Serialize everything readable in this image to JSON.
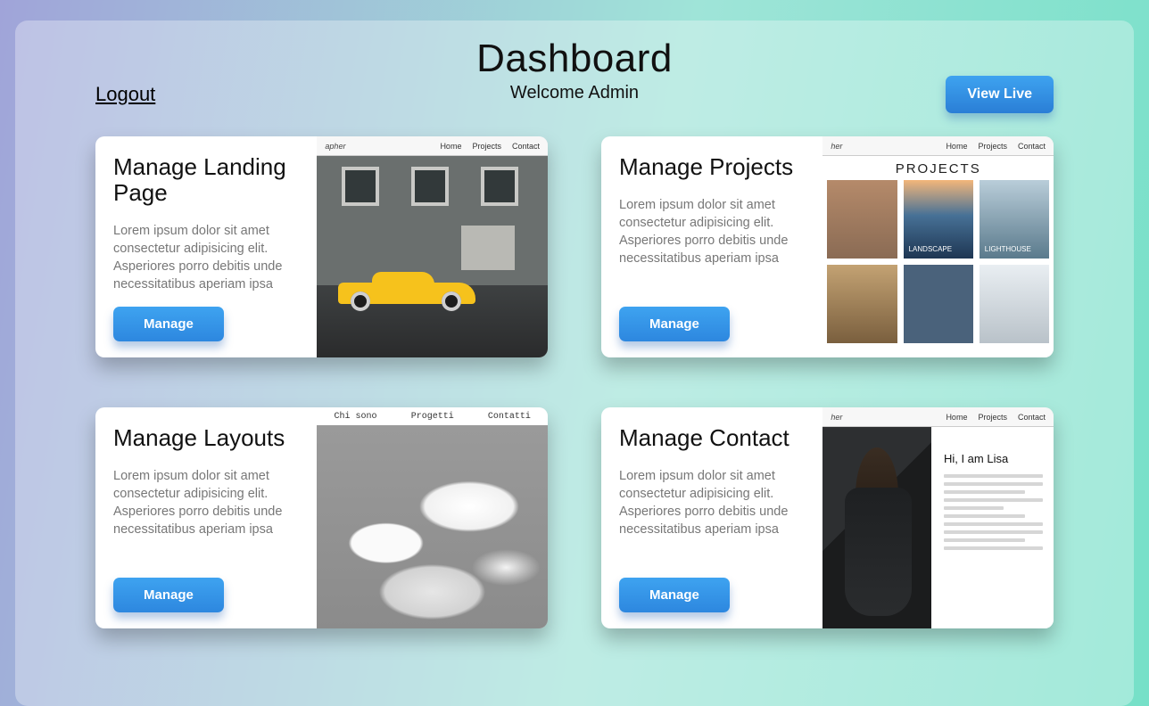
{
  "header": {
    "title": "Dashboard",
    "subtitle": "Welcome Admin",
    "logout": "Logout",
    "view_live": "View Live"
  },
  "lorem": "Lorem ipsum dolor sit amet consectetur adipisicing elit. Asperiores porro debitis unde necessitatibus aperiam ipsa",
  "manage_label": "Manage",
  "cards": [
    {
      "title": "Manage Landing Page"
    },
    {
      "title": "Manage Projects"
    },
    {
      "title": "Manage Layouts"
    },
    {
      "title": "Manage Contact"
    }
  ],
  "thumbs": {
    "nav_brand_suffix": "apher",
    "nav_links": [
      "Home",
      "Projects",
      "Contact"
    ],
    "projects_heading": "PROJECTS",
    "project_labels": [
      "",
      "LANDSCAPE",
      "LIGHTHOUSE",
      "",
      "",
      ""
    ],
    "layouts_nav": [
      "Chi sono",
      "Progetti",
      "Contatti"
    ],
    "contact_heading": "Hi, I am Lisa"
  }
}
